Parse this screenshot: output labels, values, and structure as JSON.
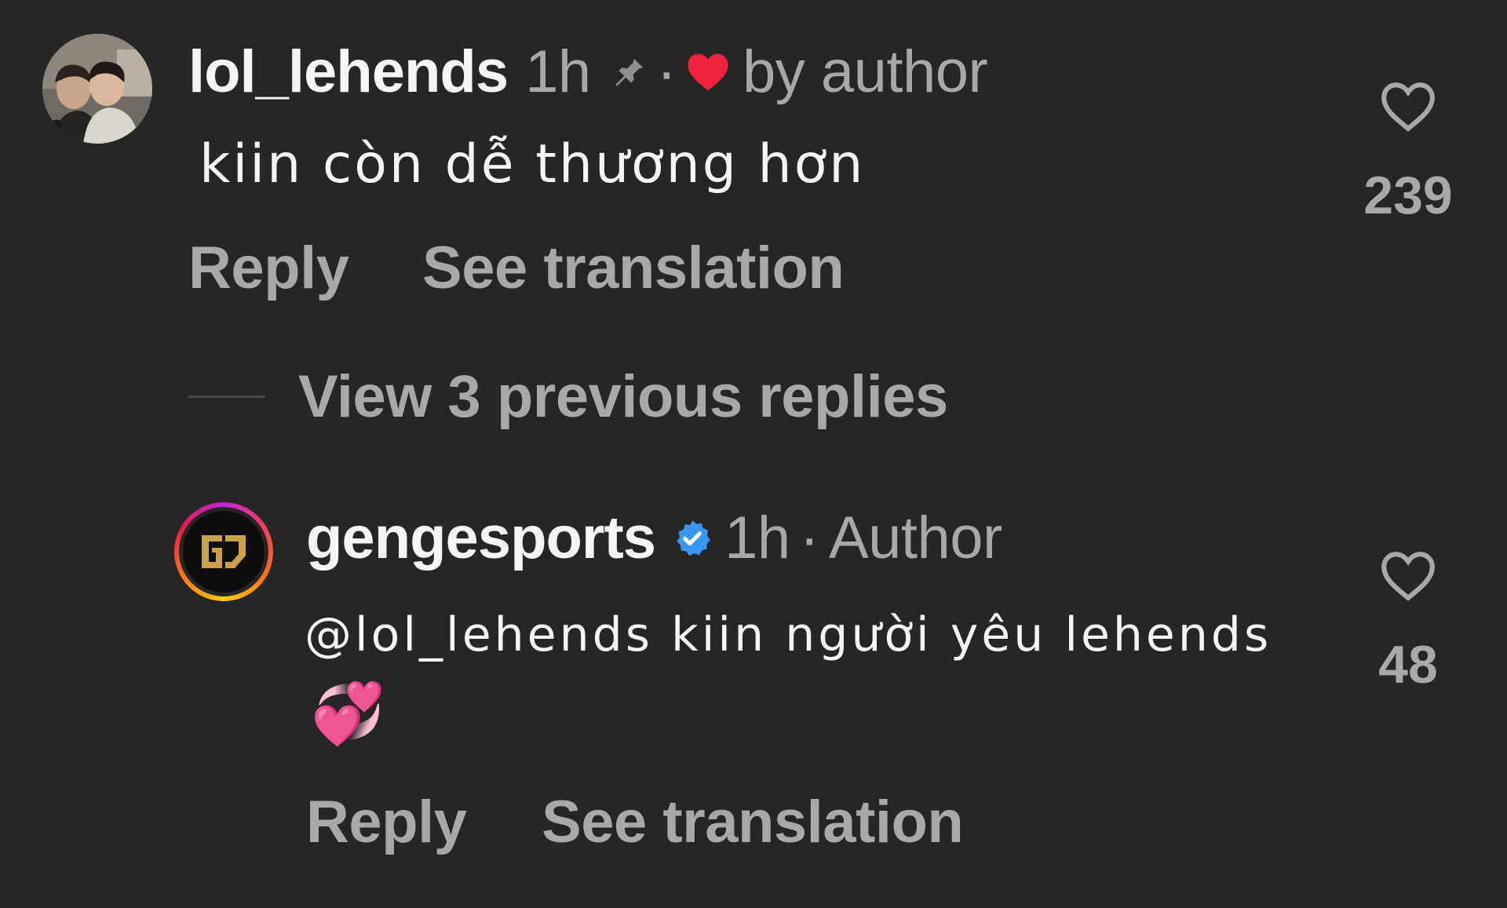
{
  "comments": [
    {
      "username": "lol_lehends",
      "time": "1h",
      "by_author": "by author",
      "text": "kiin còn dễ thương hơn",
      "reply_label": "Reply",
      "translate_label": "See translation",
      "likes": "239",
      "heart_color": "#ef233c"
    },
    {
      "username": "gengesports",
      "time": "1h",
      "badge": "Author",
      "text_line1": "@lol_lehends kiin người yêu lehends",
      "text_line2": "💞",
      "reply_label": "Reply",
      "translate_label": "See translation",
      "likes": "48",
      "verified_color": "#3897f0"
    }
  ],
  "view_replies": "View 3 previous replies",
  "icons": {
    "pin": "pin-icon",
    "liked_heart": "heart-filled-icon",
    "like": "heart-outline-icon",
    "verified": "verified-badge-icon"
  }
}
